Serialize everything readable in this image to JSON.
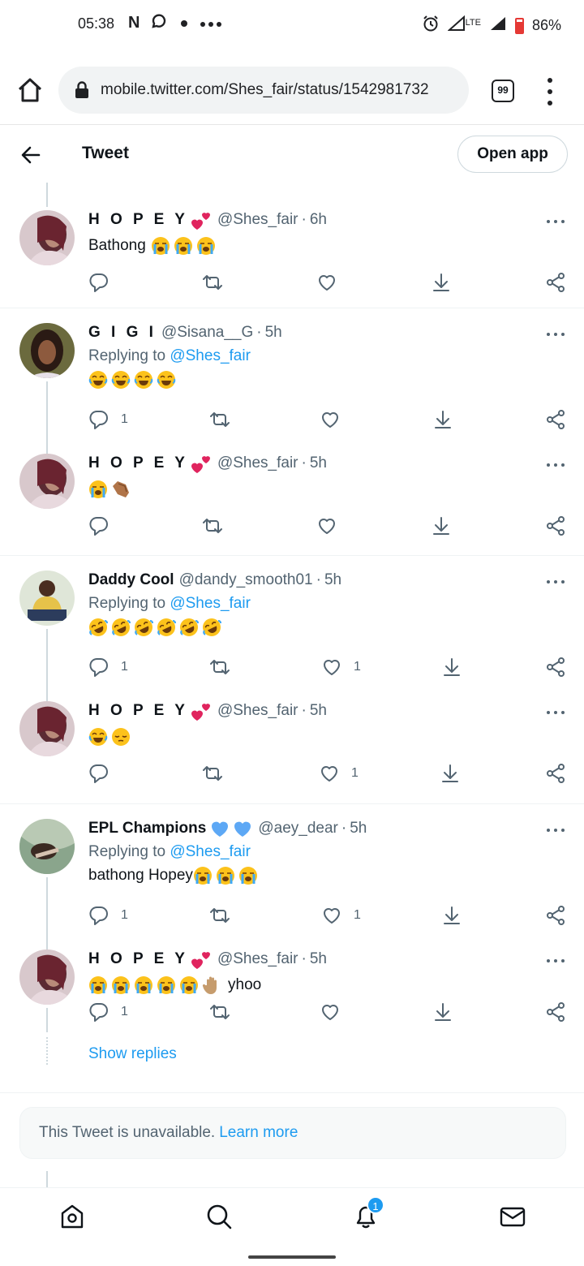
{
  "status_bar": {
    "time": "05:38",
    "network_type": "LTE",
    "battery": "86%"
  },
  "browser": {
    "url": "mobile.twitter.com/Shes_fair/status/1542981732",
    "tab_count": "99"
  },
  "header": {
    "title": "Tweet",
    "open_app_label": "Open app"
  },
  "colors": {
    "accent": "#1d9bf0",
    "secondary_text": "#536471",
    "heart_badge": "#e0245e"
  },
  "tweets": [
    {
      "name": "H O P E Y",
      "handle": "@Shes_fair",
      "time": "6h",
      "text": "Bathong",
      "emojis": [
        "loudly-crying",
        "loudly-crying",
        "loudly-crying"
      ],
      "reply_to": "",
      "replies": "",
      "likes": ""
    },
    {
      "name": "G I G I",
      "handle": "@Sisana__G",
      "time": "5h",
      "reply_to_prefix": "Replying to",
      "reply_to": "@Shes_fair",
      "text": "",
      "emojis": [
        "tears-of-joy",
        "tears-of-joy",
        "tears-of-joy",
        "tears-of-joy"
      ],
      "replies": "1",
      "likes": ""
    },
    {
      "name": "H O P E Y",
      "handle": "@Shes_fair",
      "time": "5h",
      "text": "",
      "emojis": [
        "loudly-crying",
        "coffin"
      ],
      "replies": "",
      "likes": ""
    },
    {
      "name": "Daddy Cool",
      "handle": "@dandy_smooth01",
      "time": "5h",
      "reply_to_prefix": "Replying to",
      "reply_to": "@Shes_fair",
      "text": "",
      "emojis": [
        "rolling-laughing",
        "rolling-laughing",
        "rolling-laughing",
        "rolling-laughing",
        "rolling-laughing",
        "rolling-laughing"
      ],
      "replies": "1",
      "likes": "1"
    },
    {
      "name": "H O P E Y",
      "handle": "@Shes_fair",
      "time": "5h",
      "text": "",
      "emojis": [
        "tears-of-joy",
        "pensive"
      ],
      "replies": "",
      "likes": "1"
    },
    {
      "name": "EPL Champions",
      "handle": "@aey_dear",
      "time": "5h",
      "reply_to_prefix": "Replying to",
      "reply_to": "@Shes_fair",
      "text": "bathong Hopey",
      "emojis": [
        "loudly-crying",
        "loudly-crying",
        "loudly-crying"
      ],
      "replies": "1",
      "likes": "1"
    },
    {
      "name": "H O P E Y",
      "handle": "@Shes_fair",
      "time": "5h",
      "text": "yhoo",
      "emojis": [
        "loudly-crying",
        "loudly-crying",
        "loudly-crying",
        "loudly-crying",
        "loudly-crying",
        "raised-hand"
      ],
      "replies": "1",
      "likes": ""
    }
  ],
  "show_replies": "Show replies",
  "unavailable": {
    "text": "This Tweet is unavailable.",
    "link": "Learn more"
  },
  "bottom_nav": {
    "notifications_count": "1"
  }
}
